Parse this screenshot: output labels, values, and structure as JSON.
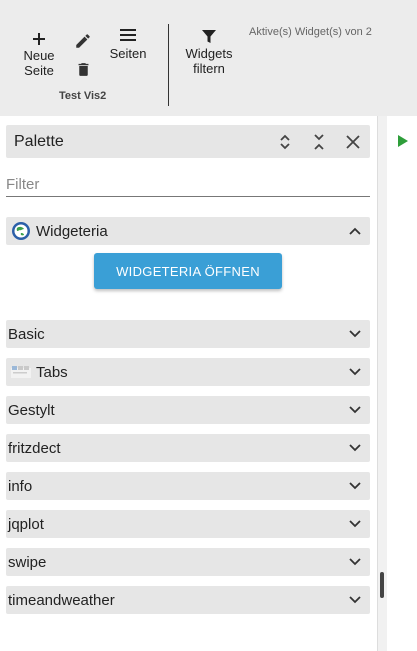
{
  "toolbar": {
    "new_page": "Neue\nSeite",
    "pages": "Seiten",
    "group_label": "Test Vis2",
    "widgets_filter": "Widgets\nfiltern",
    "active_widgets_info": "Aktive(s) Widget(s) von 2"
  },
  "palette": {
    "title": "Palette",
    "filter_placeholder": "Filter",
    "widgeteria": {
      "label": "Widgeteria",
      "button": "WIDGETERIA ÖFFNEN"
    },
    "groups": [
      {
        "label": "Basic"
      },
      {
        "label": "Tabs"
      },
      {
        "label": "Gestylt"
      },
      {
        "label": "fritzdect"
      },
      {
        "label": "info"
      },
      {
        "label": "jqplot"
      },
      {
        "label": "swipe"
      },
      {
        "label": "timeandweather"
      }
    ]
  },
  "colors": {
    "accent": "#3a9fd6",
    "play": "#2e9e3a"
  }
}
